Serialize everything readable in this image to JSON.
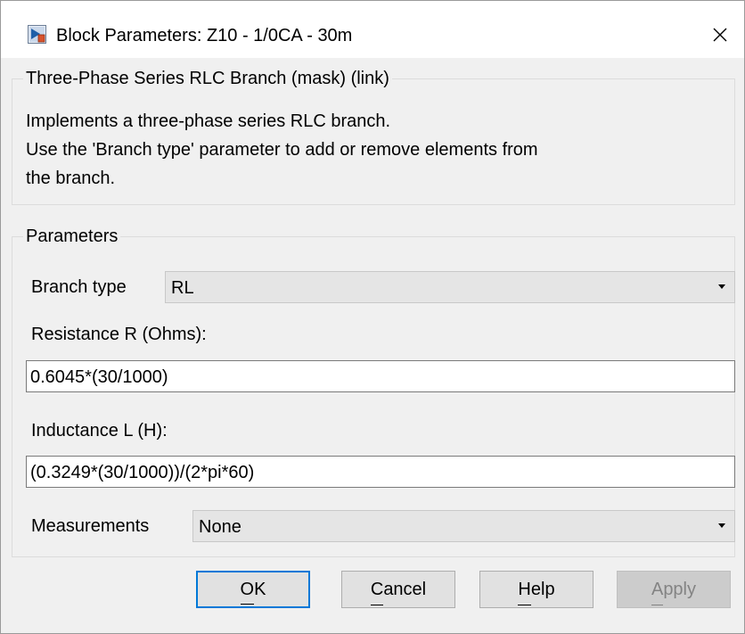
{
  "window": {
    "title": "Block Parameters: Z10 - 1/0CA - 30m",
    "icon": "simulink-block-icon",
    "close_icon": "close-icon"
  },
  "description_group": {
    "legend": "Three-Phase Series RLC Branch (mask) (link)",
    "lines": [
      "Implements a three-phase series RLC branch.",
      "Use the 'Branch type' parameter to add or remove elements from",
      "the branch."
    ]
  },
  "parameters_group": {
    "legend": "Parameters",
    "branch_type": {
      "label": "Branch type",
      "value": "RL"
    },
    "resistance": {
      "label": "Resistance R (Ohms):",
      "value": "0.6045*(30/1000)"
    },
    "inductance": {
      "label": "Inductance L (H):",
      "value": "(0.3249*(30/1000))/(2*pi*60)"
    },
    "measurements": {
      "label": "Measurements",
      "value": "None"
    }
  },
  "buttons": {
    "ok": {
      "mnemonic": "O",
      "rest": "K",
      "enabled": true
    },
    "cancel": {
      "mnemonic": "C",
      "rest": "ancel",
      "enabled": true
    },
    "help": {
      "mnemonic": "H",
      "rest": "elp",
      "enabled": true
    },
    "apply": {
      "mnemonic": "A",
      "rest": "pply",
      "enabled": false
    }
  },
  "colors": {
    "dialog_background": "#f0f0f0",
    "default_button_border": "#0078d7",
    "combo_background": "#e5e5e5",
    "disabled_text": "#838383"
  }
}
